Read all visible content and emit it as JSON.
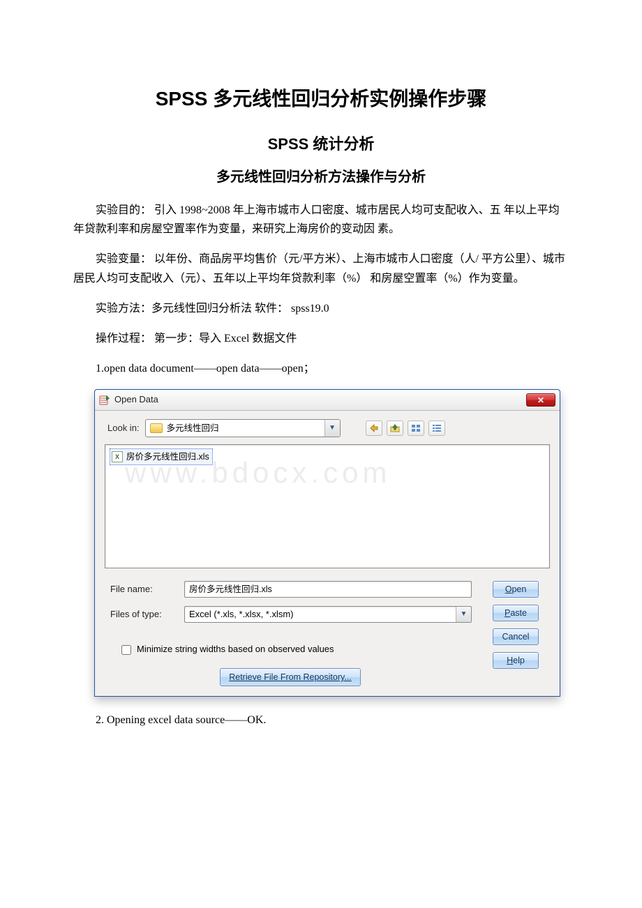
{
  "doc": {
    "title": "SPSS 多元线性回归分析实例操作步骤",
    "sub1": "SPSS 统计分析",
    "sub2": "多元线性回归分析方法操作与分析",
    "p1": "实验目的： 引入 1998~2008 年上海市城市人口密度、城市居民人均可支配收入、五 年以上平均年贷款利率和房屋空置率作为变量，来研究上海房价的变动因 素。",
    "p2": "实验变量： 以年份、商品房平均售价（元/平方米）、上海市城市人口密度（人/ 平方公里）、城市居民人均可支配收入（元）、五年以上平均年贷款利率（%） 和房屋空置率（%）作为变量。",
    "p3": "实验方法：多元线性回归分析法 软件： spss19.0",
    "p4": "操作过程： 第一步：导入 Excel 数据文件",
    "p5": "1.open data document——open data——open；",
    "p6": "2. Opening excel data source——OK."
  },
  "dialog": {
    "title": "Open Data",
    "lookin_label": "Look in:",
    "folder_name": "多元线性回归",
    "file_item": "房价多元线性回归.xls",
    "watermark": "www.bdocx.com",
    "file_name_label": "File name:",
    "file_name_value": "房价多元线性回归.xls",
    "file_type_label": "Files of type:",
    "file_type_value": "Excel (*.xls, *.xlsx, *.xlsm)",
    "checkbox_label": "Minimize string widths based on observed values",
    "repo_btn": "Retrieve File From Repository...",
    "buttons": {
      "open": "Open",
      "paste": "Paste",
      "cancel": "Cancel",
      "help": "Help"
    }
  }
}
